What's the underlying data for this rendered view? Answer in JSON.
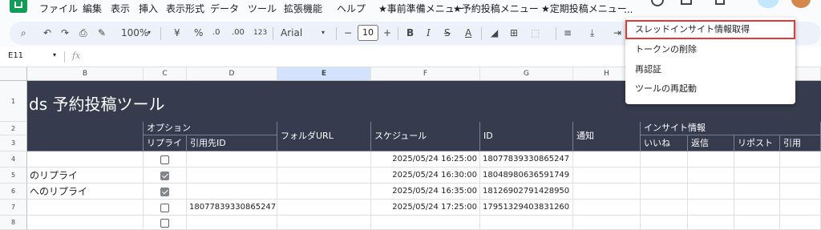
{
  "menubar": {
    "items": [
      "ファイル",
      "編集",
      "表示",
      "挿入",
      "表示形式",
      "データ",
      "ツール",
      "拡張機能",
      "ヘルプ",
      "★事前準備メニュー",
      "★予約投稿メニュー",
      "★定期投稿メニュー"
    ],
    "overflow": "..."
  },
  "toolbar": {
    "zoom": "100%",
    "currency": "¥",
    "percent": "%",
    "dec_decrease": ".0",
    "dec_increase": ".00",
    "number_format": "123",
    "font": "Arial",
    "font_size": "10",
    "minus": "−",
    "plus": "+",
    "bold": "B",
    "italic": "I",
    "text_color": "A"
  },
  "formula_bar": {
    "cell_ref": "E11",
    "fx": "fx",
    "value": ""
  },
  "columns": [
    "B",
    "C",
    "D",
    "E",
    "F",
    "G",
    "H"
  ],
  "rows": [
    "1",
    "2",
    "3",
    "4",
    "5",
    "6",
    "7",
    "8"
  ],
  "sheet": {
    "title": "ds 予約投稿ツール",
    "headers": {
      "option": "オプション",
      "reply": "リプライ",
      "quote_id": "引用先ID",
      "folder_url": "フォルダURL",
      "schedule": "スケジュール",
      "id": "ID",
      "notify": "通知",
      "insight": "インサイト情報",
      "likes": "いいね",
      "replies": "返信",
      "reposts": "リポスト",
      "quotes": "引用"
    },
    "data_rows": [
      {
        "b": "",
        "reply_checked": false,
        "quote_id": "",
        "schedule": "2025/05/24 16:25:00",
        "id": "18077839330865247"
      },
      {
        "b": "のリプライ",
        "reply_checked": true,
        "quote_id": "",
        "schedule": "2025/05/24 16:30:00",
        "id": "18048980636591749"
      },
      {
        "b": "へのリプライ",
        "reply_checked": true,
        "quote_id": "",
        "schedule": "2025/05/24 16:35:00",
        "id": "18126902791428950"
      },
      {
        "b": "",
        "reply_checked": false,
        "quote_id": "18077839330865247",
        "schedule": "2025/05/24 17:25:00",
        "id": "17951329403831260"
      },
      {
        "b": "",
        "reply_checked": false,
        "quote_id": "",
        "schedule": "",
        "id": ""
      }
    ]
  },
  "dropdown": {
    "items": [
      "スレッドインサイト情報取得",
      "トークンの削除",
      "再認証",
      "ツールの再起動"
    ],
    "highlighted_index": 0
  }
}
